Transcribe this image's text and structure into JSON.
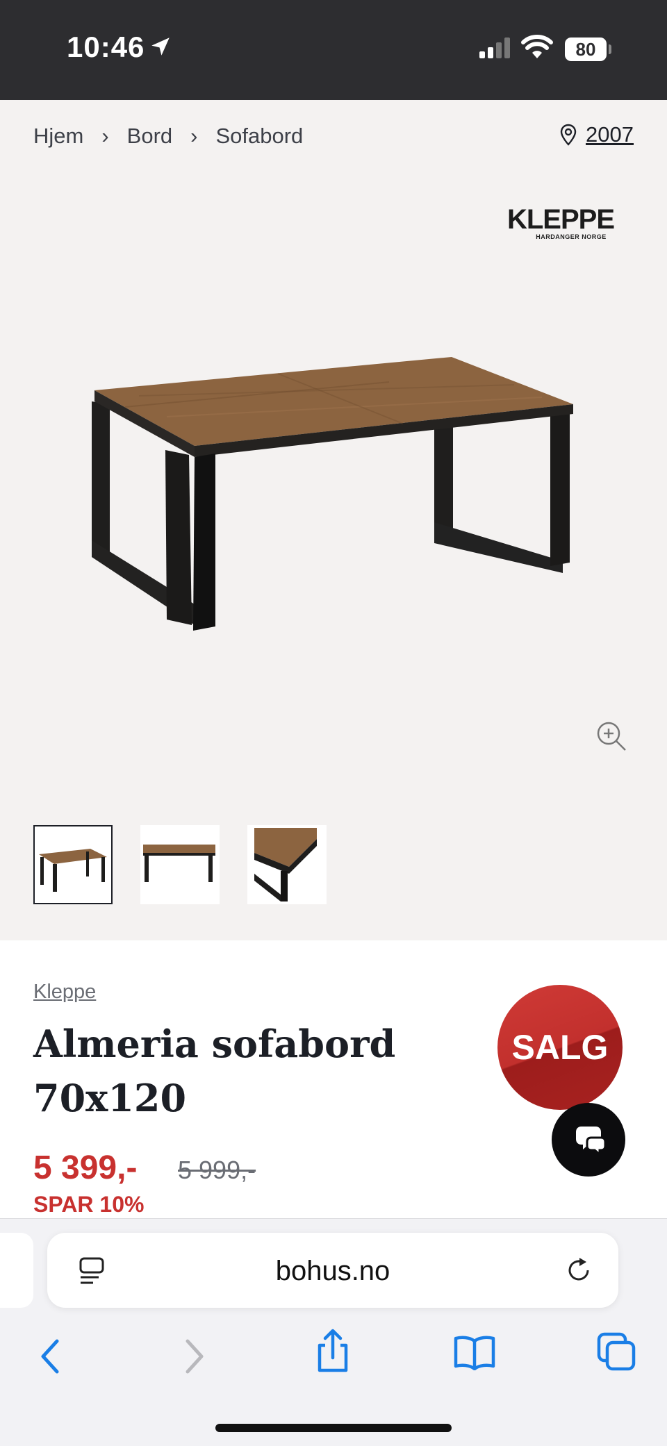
{
  "status": {
    "time": "10:46",
    "battery": "80"
  },
  "breadcrumb": {
    "items": [
      "Hjem",
      "Bord",
      "Sofabord"
    ],
    "separator": "›"
  },
  "store": {
    "code": "2007"
  },
  "brand_logo": {
    "name": "KLEPPE",
    "subtitle": "HARDANGER NORGE"
  },
  "product": {
    "brand": "Kleppe",
    "title_line1": "Almeria sofabord",
    "title_line2": "70x120",
    "price": "5 399,-",
    "old_price": "5 999,-",
    "saving": "SPAR 10%",
    "badge": "SALG"
  },
  "browser": {
    "url": "bohus.no"
  },
  "colors": {
    "sale_red": "#c8312f",
    "status_bar": "#2d2d30",
    "ios_blue": "#1a7ee6"
  }
}
